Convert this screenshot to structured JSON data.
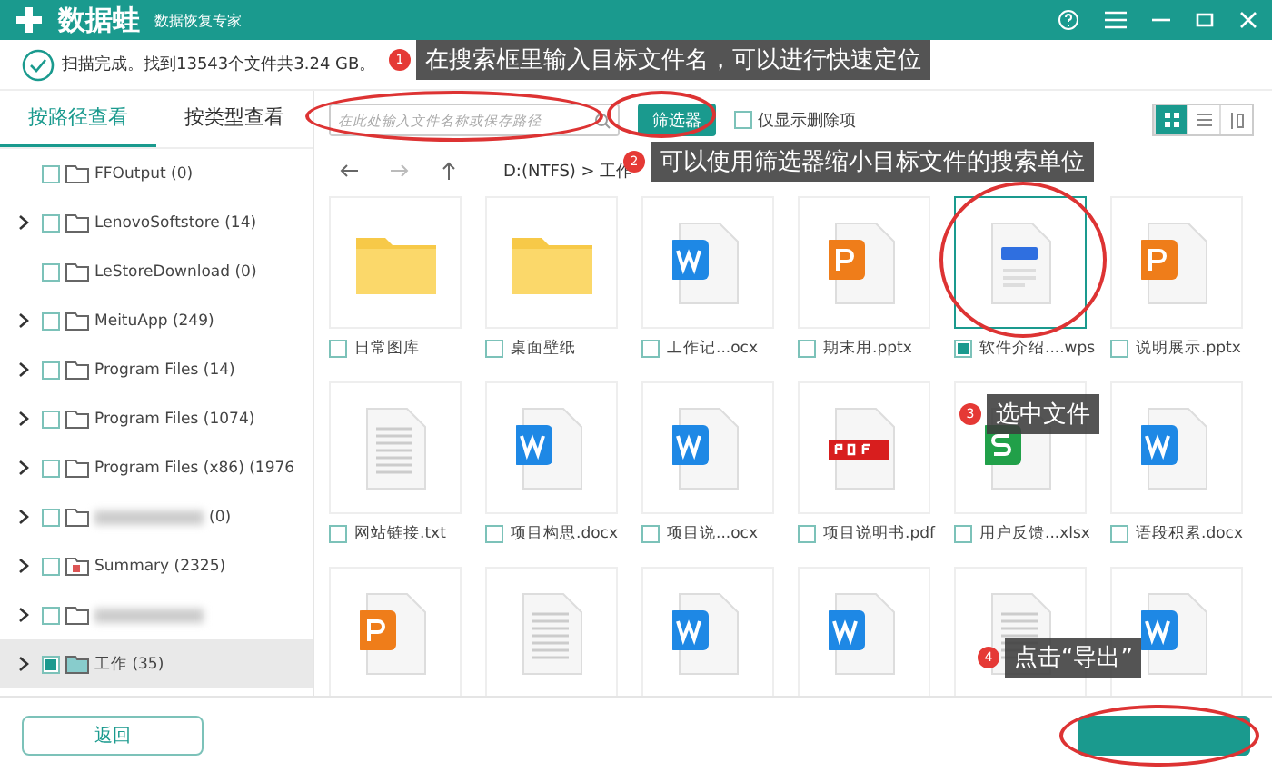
{
  "header": {
    "app_name": "数据蛙",
    "subtitle": "数据恢复专家"
  },
  "status": {
    "text": "扫描完成。找到13543个文件共3.24 GB。"
  },
  "tabs": [
    {
      "label": "按路径查看",
      "selected": true
    },
    {
      "label": "按类型查看",
      "selected": false
    }
  ],
  "toolbar": {
    "search_placeholder": "在此处输入文件名称或保存路径",
    "filter_button": "筛选器",
    "only_deleted": {
      "label": "仅显示删除项",
      "checked": false
    },
    "view_modes": [
      {
        "selected": true
      },
      {
        "selected": false
      },
      {
        "selected": false
      }
    ]
  },
  "breadcrumb": "D:(NTFS) > 工作",
  "tree": [
    {
      "kind": "folder",
      "label": "FFOutput (0)",
      "expandable": false,
      "checked": false,
      "selected": false
    },
    {
      "kind": "folder",
      "label": "LenovoSoftstore (14)",
      "expandable": true,
      "checked": false,
      "selected": false
    },
    {
      "kind": "folder",
      "label": "LeStoreDownload (0)",
      "expandable": false,
      "checked": false,
      "selected": false
    },
    {
      "kind": "folder",
      "label": "MeituApp (249)",
      "expandable": true,
      "checked": false,
      "selected": false
    },
    {
      "kind": "folder",
      "label": "Program Files (14)",
      "expandable": true,
      "checked": false,
      "selected": false
    },
    {
      "kind": "folder",
      "label": "Program Files (1074)",
      "expandable": true,
      "checked": false,
      "selected": false
    },
    {
      "kind": "folder",
      "label": "Program Files (x86) (1976",
      "expandable": true,
      "checked": false,
      "selected": false
    },
    {
      "kind": "blurred",
      "label": "(0)",
      "expandable": true,
      "checked": false,
      "selected": false
    },
    {
      "kind": "document",
      "label": "Summary (2325)",
      "expandable": true,
      "checked": false,
      "selected": false
    },
    {
      "kind": "blurred",
      "expandable": true,
      "checked": false,
      "selected": false
    },
    {
      "kind": "folder",
      "label": "工作 (35)",
      "expandable": true,
      "checked": true,
      "selected": true
    }
  ],
  "files": [
    {
      "kind": "folder",
      "name": "日常图库",
      "checked": false,
      "selected": false
    },
    {
      "kind": "folder",
      "name": "桌面壁纸",
      "checked": false,
      "selected": false
    },
    {
      "kind": "word",
      "name": "工作记...ocx",
      "checked": false,
      "selected": false
    },
    {
      "kind": "ppt",
      "name": "期末用.pptx",
      "checked": false,
      "selected": false
    },
    {
      "kind": "wps",
      "name": "软件介绍....wps",
      "checked": true,
      "selected": true
    },
    {
      "kind": "ppt",
      "name": "说明展示.pptx",
      "checked": false,
      "selected": false
    },
    {
      "kind": "txt",
      "name": "网站链接.txt",
      "checked": false,
      "selected": false
    },
    {
      "kind": "word",
      "name": "项目构思.docx",
      "checked": false,
      "selected": false
    },
    {
      "kind": "word",
      "name": "项目说...ocx",
      "checked": false,
      "selected": false
    },
    {
      "kind": "pdf",
      "name": "项目说明书.pdf",
      "checked": false,
      "selected": false
    },
    {
      "kind": "excel",
      "name": "用户反馈...xlsx",
      "checked": false,
      "selected": false
    },
    {
      "kind": "word",
      "name": "语段积累.docx",
      "checked": false,
      "selected": false
    },
    {
      "kind": "ppt"
    },
    {
      "kind": "txt"
    },
    {
      "kind": "word"
    },
    {
      "kind": "word"
    },
    {
      "kind": "txt"
    },
    {
      "kind": "word"
    }
  ],
  "footer": {
    "back_button": "返回"
  },
  "annotations": [
    {
      "number": "1",
      "text": "在搜索框里输入目标文件名，可以进行快速定位"
    },
    {
      "number": "2",
      "text": "可以使用筛选器缩小目标文件的搜索单位"
    },
    {
      "number": "3",
      "text": "选中文件"
    },
    {
      "number": "4",
      "text": "点击“导出”"
    }
  ]
}
